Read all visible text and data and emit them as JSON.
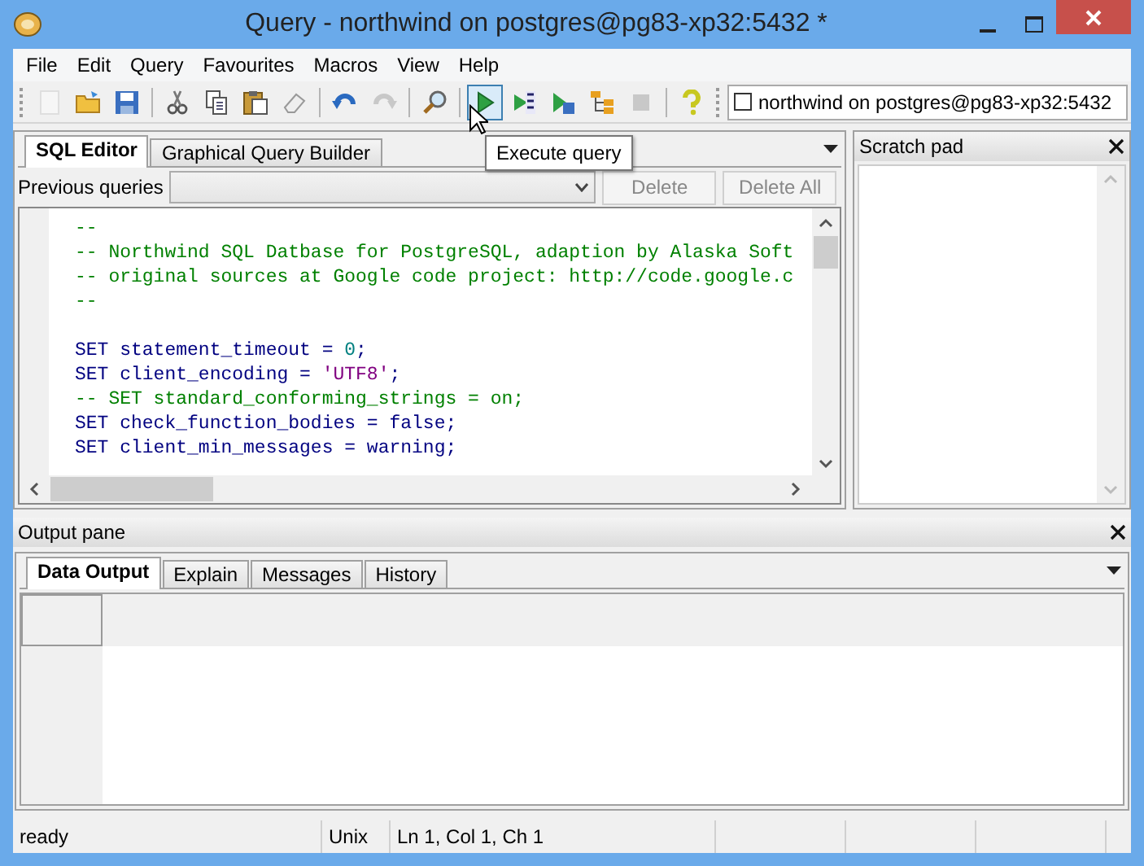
{
  "window": {
    "title": "Query - northwind on postgres@pg83-xp32:5432 *"
  },
  "menu": [
    "File",
    "Edit",
    "Query",
    "Favourites",
    "Macros",
    "View",
    "Help"
  ],
  "toolbar": [
    {
      "kind": "button",
      "disabled": true,
      "hovered": false
    },
    {
      "kind": "button",
      "disabled": false,
      "hovered": false
    },
    {
      "kind": "button",
      "disabled": false,
      "hovered": false
    },
    {
      "kind": "separator"
    },
    {
      "kind": "button",
      "disabled": false,
      "hovered": false
    },
    {
      "kind": "button",
      "disabled": false,
      "hovered": false
    },
    {
      "kind": "button",
      "disabled": false,
      "hovered": false
    },
    {
      "kind": "button",
      "disabled": false,
      "hovered": false
    },
    {
      "kind": "separator"
    },
    {
      "kind": "button",
      "disabled": false,
      "hovered": false
    },
    {
      "kind": "button",
      "disabled": true,
      "hovered": false
    },
    {
      "kind": "separator"
    },
    {
      "kind": "button",
      "disabled": false,
      "hovered": false
    },
    {
      "kind": "separator"
    },
    {
      "kind": "button",
      "disabled": false,
      "hovered": true
    },
    {
      "kind": "button",
      "disabled": false,
      "hovered": false
    },
    {
      "kind": "button",
      "disabled": false,
      "hovered": false
    },
    {
      "kind": "button",
      "disabled": false,
      "hovered": false
    },
    {
      "kind": "button",
      "disabled": true,
      "hovered": false
    },
    {
      "kind": "separator"
    },
    {
      "kind": "button",
      "disabled": false,
      "hovered": false
    }
  ],
  "connection": {
    "checked": false,
    "label": "northwind on postgres@pg83-xp32:5432"
  },
  "tooltip": "Execute query",
  "editor_tabs": [
    {
      "label": "SQL Editor",
      "selected": true
    },
    {
      "label": "Graphical Query Builder",
      "selected": false
    }
  ],
  "previous_queries": {
    "label": "Previous queries",
    "buttons": [
      {
        "label": "Delete",
        "disabled": true
      },
      {
        "label": "Delete All",
        "disabled": true
      }
    ]
  },
  "code_blocks": [
    [
      [
        {
          "kind": "comment",
          "text": "--"
        }
      ],
      [
        {
          "kind": "comment",
          "text": "-- Northwind SQL Datbase for PostgreSQL, adaption by Alaska Soft"
        }
      ],
      [
        {
          "kind": "comment",
          "text": "-- original sources at Google code project: http://code.google.c"
        }
      ],
      [
        {
          "kind": "comment",
          "text": "--"
        }
      ]
    ],
    [
      [
        {
          "kind": "keyword",
          "text": "SET statement_timeout = "
        },
        {
          "kind": "number",
          "text": "0"
        },
        {
          "kind": "keyword",
          "text": ";"
        }
      ],
      [
        {
          "kind": "keyword",
          "text": "SET client_encoding = "
        },
        {
          "kind": "string",
          "text": "'UTF8'"
        },
        {
          "kind": "keyword",
          "text": ";"
        }
      ],
      [
        {
          "kind": "comment",
          "text": "-- SET standard_conforming_strings = on;"
        }
      ],
      [
        {
          "kind": "keyword",
          "text": "SET check_function_bodies = false;"
        }
      ],
      [
        {
          "kind": "keyword",
          "text": "SET client_min_messages = warning;"
        }
      ]
    ]
  ],
  "scratch_pad": {
    "title": "Scratch pad"
  },
  "output_pane": {
    "title": "Output pane",
    "tabs": [
      {
        "label": "Data Output",
        "selected": true
      },
      {
        "label": "Explain",
        "selected": false
      },
      {
        "label": "Messages",
        "selected": false
      },
      {
        "label": "History",
        "selected": false
      }
    ]
  },
  "status_bar": [
    "ready",
    "Unix",
    "Ln 1, Col 1, Ch 1"
  ]
}
